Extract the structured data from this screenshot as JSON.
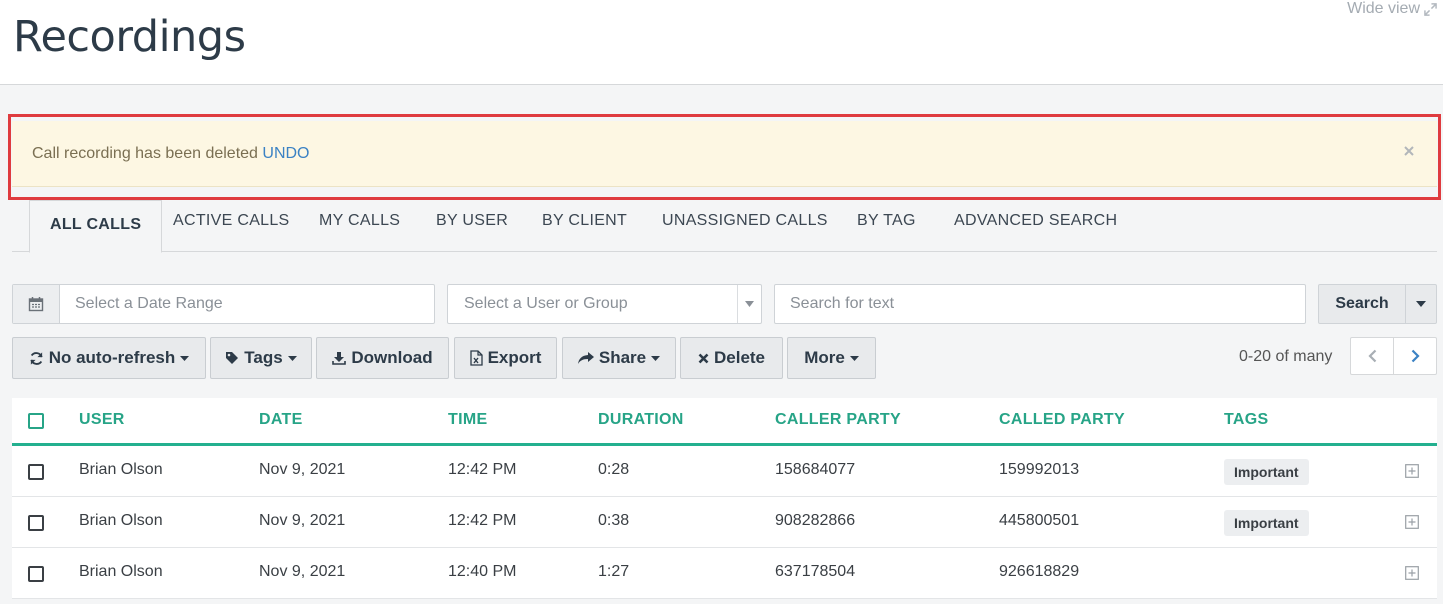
{
  "header": {
    "title": "Recordings",
    "wide_view": "Wide view"
  },
  "alert": {
    "message": "Call recording has been deleted",
    "action": "UNDO"
  },
  "tabs": [
    {
      "label": "ALL CALLS",
      "active": true
    },
    {
      "label": "ACTIVE CALLS"
    },
    {
      "label": "MY CALLS"
    },
    {
      "label": "BY USER"
    },
    {
      "label": "BY CLIENT"
    },
    {
      "label": "UNASSIGNED CALLS"
    },
    {
      "label": "BY TAG"
    },
    {
      "label": "ADVANCED SEARCH"
    }
  ],
  "filters": {
    "date_placeholder": "Select a Date Range",
    "user_placeholder": "Select a User or Group",
    "text_placeholder": "Search for text",
    "search_label": "Search"
  },
  "toolbar": {
    "refresh_label": "No auto-refresh",
    "tags_label": "Tags",
    "download_label": "Download",
    "export_label": "Export",
    "share_label": "Share",
    "delete_label": "Delete",
    "more_label": "More",
    "pager_text": "0-20 of many"
  },
  "table": {
    "columns": [
      "USER",
      "DATE",
      "TIME",
      "DURATION",
      "CALLER PARTY",
      "CALLED PARTY",
      "TAGS"
    ],
    "rows": [
      {
        "user": "Brian Olson",
        "date": "Nov 9, 2021",
        "time": "12:42 PM",
        "duration": "0:28",
        "caller": "158684077",
        "called": "159992013",
        "tag": "Important"
      },
      {
        "user": "Brian Olson",
        "date": "Nov 9, 2021",
        "time": "12:42 PM",
        "duration": "0:38",
        "caller": "908282866",
        "called": "445800501",
        "tag": "Important"
      },
      {
        "user": "Brian Olson",
        "date": "Nov 9, 2021",
        "time": "12:40 PM",
        "duration": "1:27",
        "caller": "637178504",
        "called": "926618829",
        "tag": ""
      }
    ]
  },
  "colors": {
    "accent": "#27a487",
    "alert_bg": "#fdf7e3",
    "highlight": "#df3b3f",
    "link": "#3b82c4"
  }
}
